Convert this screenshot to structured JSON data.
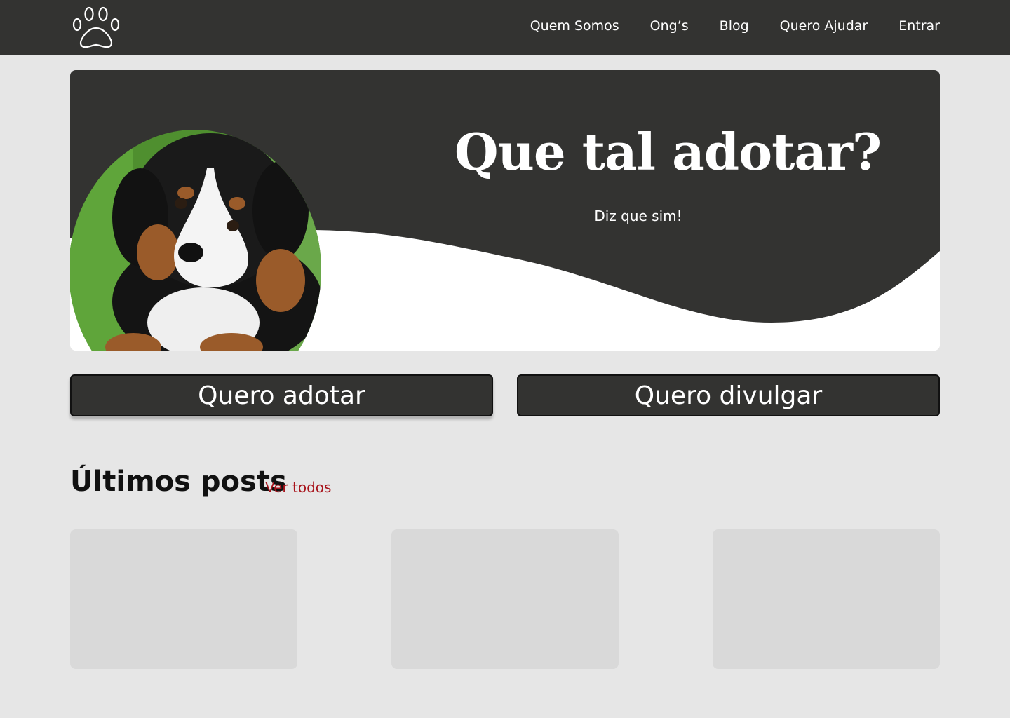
{
  "header": {
    "logo_icon": "paw-icon",
    "nav": [
      {
        "label": "Quem Somos"
      },
      {
        "label": "Ong’s"
      },
      {
        "label": "Blog"
      },
      {
        "label": "Quero Ajudar"
      },
      {
        "label": "Entrar"
      }
    ]
  },
  "hero": {
    "title": "Que tal adotar?",
    "subtitle": "Diz que sim!",
    "image": "puppy-photo"
  },
  "actions": {
    "adopt_label": "Quero adotar",
    "share_label": "Quero divulgar"
  },
  "posts": {
    "title": "Últimos posts",
    "see_all_label": "Ver todos",
    "cards": [
      {},
      {},
      {}
    ]
  },
  "colors": {
    "dark": "#333331",
    "background": "#e6e6e6",
    "card": "#d9d9d9",
    "link": "#a8131b"
  }
}
